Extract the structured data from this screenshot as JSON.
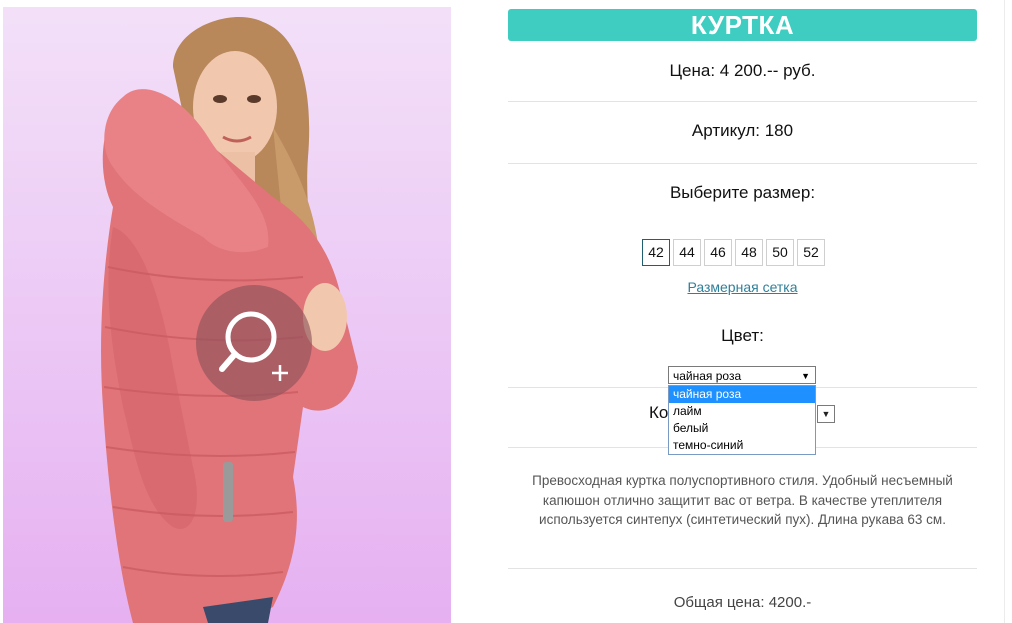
{
  "product": {
    "title": "КУРТКА",
    "price": "Цена: 4 200.-- руб.",
    "article": "Артикул: 180",
    "size_prompt": "Выберите размер:",
    "sizes": [
      "42",
      "44",
      "46",
      "48",
      "50",
      "52"
    ],
    "selected_size": "42",
    "size_chart_link": "Размерная сетка",
    "color_label": "Цвет:",
    "color_selected": "чайная роза",
    "color_options": [
      "чайная роза",
      "лайм",
      "белый",
      "темно-синий"
    ],
    "quantity_label_partial": "Ко",
    "description": "Превосходная куртка полуспортивного стиля. Удобный несъемный капюшон отлично защитит вас от ветра. В качестве утеплителя используется синтепух (синтетический пух). Длина рукава 63 см.",
    "total": "Общая цена: 4200.-"
  },
  "icons": {
    "zoom": "zoom-in-icon",
    "dropdown_arrow": "triangle-down-icon"
  },
  "colors": {
    "accent": "#3fcdc2",
    "link": "#2f7f9a",
    "dropdown_highlight": "#1e90ff",
    "jacket": "#e07478"
  }
}
